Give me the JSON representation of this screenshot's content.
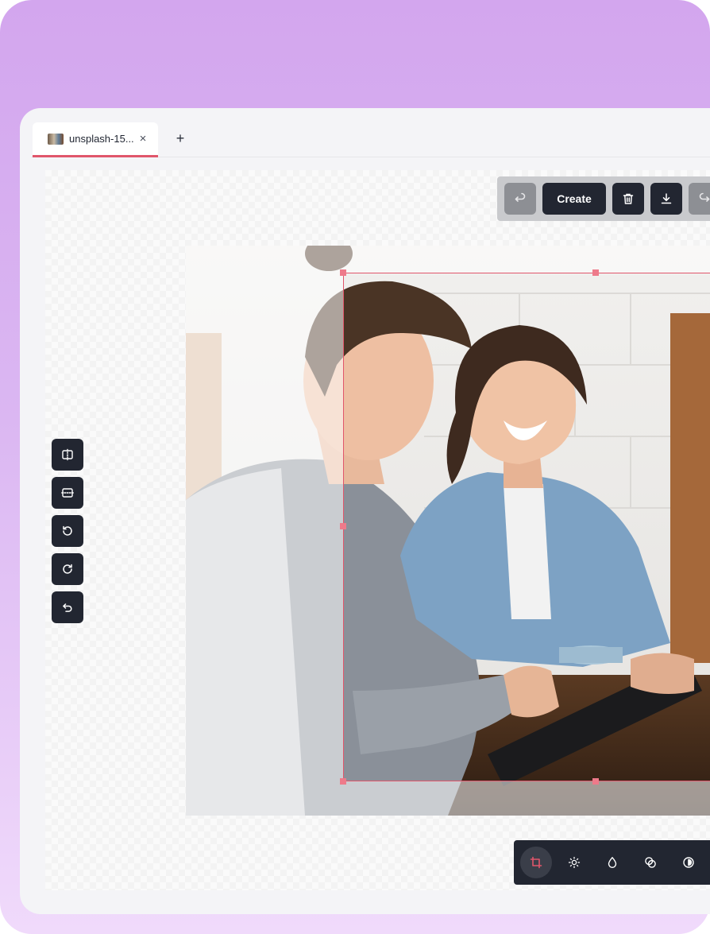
{
  "tabs": [
    {
      "label": "unsplash-15...",
      "thumbnail": "photo-thumbnail",
      "active": true
    }
  ],
  "tab_add_label": "+",
  "tab_close_label": "×",
  "toolbar": {
    "undo_icon": "undo-icon",
    "create_label": "Create",
    "delete_icon": "trash-icon",
    "download_icon": "download-icon",
    "redo_icon": "redo-icon"
  },
  "left_tools": [
    {
      "name": "flip-horizontal",
      "icon": "flip-horizontal-icon"
    },
    {
      "name": "flip-vertical",
      "icon": "flip-vertical-icon"
    },
    {
      "name": "rotate-left",
      "icon": "rotate-left-icon"
    },
    {
      "name": "rotate-right",
      "icon": "rotate-right-icon"
    },
    {
      "name": "reset",
      "icon": "reset-icon"
    }
  ],
  "adjust_tools": [
    {
      "name": "crop",
      "icon": "crop-icon",
      "active": true
    },
    {
      "name": "brightness",
      "icon": "sun-icon",
      "active": false
    },
    {
      "name": "saturation",
      "icon": "droplet-icon",
      "active": false
    },
    {
      "name": "filters",
      "icon": "overlap-circles-icon",
      "active": false
    },
    {
      "name": "contrast",
      "icon": "contrast-icon",
      "active": false
    }
  ],
  "colors": {
    "accent": "#e0566b",
    "button_dark": "#222631",
    "background_gradient_top": "#d3a6ee",
    "background_gradient_bottom": "#f0dafb"
  }
}
